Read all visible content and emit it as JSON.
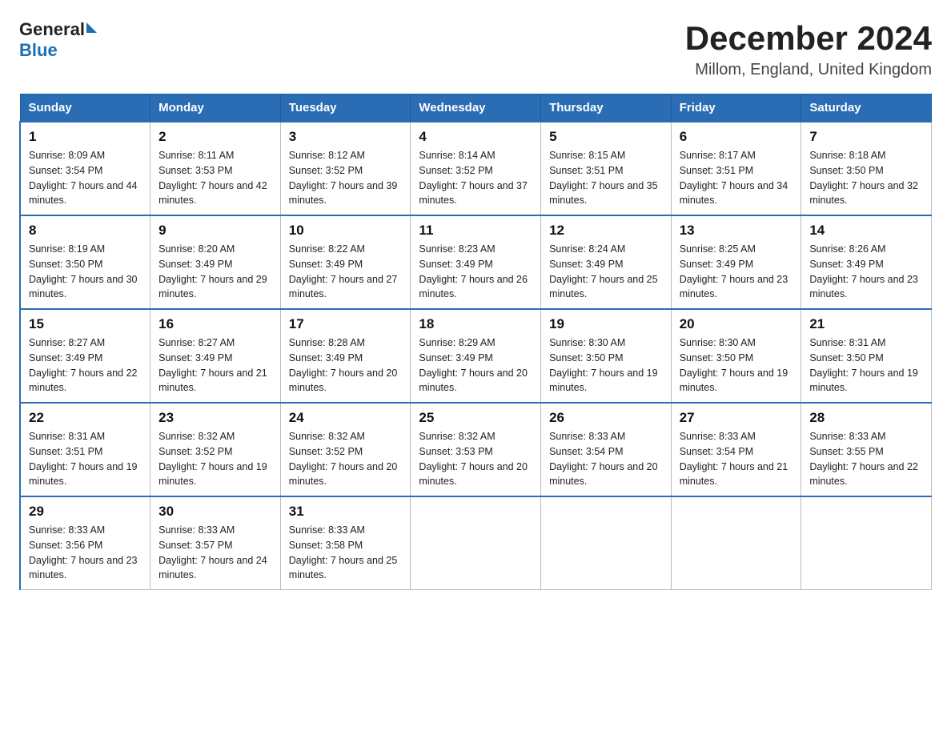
{
  "header": {
    "title": "December 2024",
    "subtitle": "Millom, England, United Kingdom",
    "logo_general": "General",
    "logo_blue": "Blue"
  },
  "weekdays": [
    "Sunday",
    "Monday",
    "Tuesday",
    "Wednesday",
    "Thursday",
    "Friday",
    "Saturday"
  ],
  "weeks": [
    [
      {
        "day": "1",
        "sunrise": "8:09 AM",
        "sunset": "3:54 PM",
        "daylight": "7 hours and 44 minutes."
      },
      {
        "day": "2",
        "sunrise": "8:11 AM",
        "sunset": "3:53 PM",
        "daylight": "7 hours and 42 minutes."
      },
      {
        "day": "3",
        "sunrise": "8:12 AM",
        "sunset": "3:52 PM",
        "daylight": "7 hours and 39 minutes."
      },
      {
        "day": "4",
        "sunrise": "8:14 AM",
        "sunset": "3:52 PM",
        "daylight": "7 hours and 37 minutes."
      },
      {
        "day": "5",
        "sunrise": "8:15 AM",
        "sunset": "3:51 PM",
        "daylight": "7 hours and 35 minutes."
      },
      {
        "day": "6",
        "sunrise": "8:17 AM",
        "sunset": "3:51 PM",
        "daylight": "7 hours and 34 minutes."
      },
      {
        "day": "7",
        "sunrise": "8:18 AM",
        "sunset": "3:50 PM",
        "daylight": "7 hours and 32 minutes."
      }
    ],
    [
      {
        "day": "8",
        "sunrise": "8:19 AM",
        "sunset": "3:50 PM",
        "daylight": "7 hours and 30 minutes."
      },
      {
        "day": "9",
        "sunrise": "8:20 AM",
        "sunset": "3:49 PM",
        "daylight": "7 hours and 29 minutes."
      },
      {
        "day": "10",
        "sunrise": "8:22 AM",
        "sunset": "3:49 PM",
        "daylight": "7 hours and 27 minutes."
      },
      {
        "day": "11",
        "sunrise": "8:23 AM",
        "sunset": "3:49 PM",
        "daylight": "7 hours and 26 minutes."
      },
      {
        "day": "12",
        "sunrise": "8:24 AM",
        "sunset": "3:49 PM",
        "daylight": "7 hours and 25 minutes."
      },
      {
        "day": "13",
        "sunrise": "8:25 AM",
        "sunset": "3:49 PM",
        "daylight": "7 hours and 23 minutes."
      },
      {
        "day": "14",
        "sunrise": "8:26 AM",
        "sunset": "3:49 PM",
        "daylight": "7 hours and 23 minutes."
      }
    ],
    [
      {
        "day": "15",
        "sunrise": "8:27 AM",
        "sunset": "3:49 PM",
        "daylight": "7 hours and 22 minutes."
      },
      {
        "day": "16",
        "sunrise": "8:27 AM",
        "sunset": "3:49 PM",
        "daylight": "7 hours and 21 minutes."
      },
      {
        "day": "17",
        "sunrise": "8:28 AM",
        "sunset": "3:49 PM",
        "daylight": "7 hours and 20 minutes."
      },
      {
        "day": "18",
        "sunrise": "8:29 AM",
        "sunset": "3:49 PM",
        "daylight": "7 hours and 20 minutes."
      },
      {
        "day": "19",
        "sunrise": "8:30 AM",
        "sunset": "3:50 PM",
        "daylight": "7 hours and 19 minutes."
      },
      {
        "day": "20",
        "sunrise": "8:30 AM",
        "sunset": "3:50 PM",
        "daylight": "7 hours and 19 minutes."
      },
      {
        "day": "21",
        "sunrise": "8:31 AM",
        "sunset": "3:50 PM",
        "daylight": "7 hours and 19 minutes."
      }
    ],
    [
      {
        "day": "22",
        "sunrise": "8:31 AM",
        "sunset": "3:51 PM",
        "daylight": "7 hours and 19 minutes."
      },
      {
        "day": "23",
        "sunrise": "8:32 AM",
        "sunset": "3:52 PM",
        "daylight": "7 hours and 19 minutes."
      },
      {
        "day": "24",
        "sunrise": "8:32 AM",
        "sunset": "3:52 PM",
        "daylight": "7 hours and 20 minutes."
      },
      {
        "day": "25",
        "sunrise": "8:32 AM",
        "sunset": "3:53 PM",
        "daylight": "7 hours and 20 minutes."
      },
      {
        "day": "26",
        "sunrise": "8:33 AM",
        "sunset": "3:54 PM",
        "daylight": "7 hours and 20 minutes."
      },
      {
        "day": "27",
        "sunrise": "8:33 AM",
        "sunset": "3:54 PM",
        "daylight": "7 hours and 21 minutes."
      },
      {
        "day": "28",
        "sunrise": "8:33 AM",
        "sunset": "3:55 PM",
        "daylight": "7 hours and 22 minutes."
      }
    ],
    [
      {
        "day": "29",
        "sunrise": "8:33 AM",
        "sunset": "3:56 PM",
        "daylight": "7 hours and 23 minutes."
      },
      {
        "day": "30",
        "sunrise": "8:33 AM",
        "sunset": "3:57 PM",
        "daylight": "7 hours and 24 minutes."
      },
      {
        "day": "31",
        "sunrise": "8:33 AM",
        "sunset": "3:58 PM",
        "daylight": "7 hours and 25 minutes."
      },
      null,
      null,
      null,
      null
    ]
  ]
}
